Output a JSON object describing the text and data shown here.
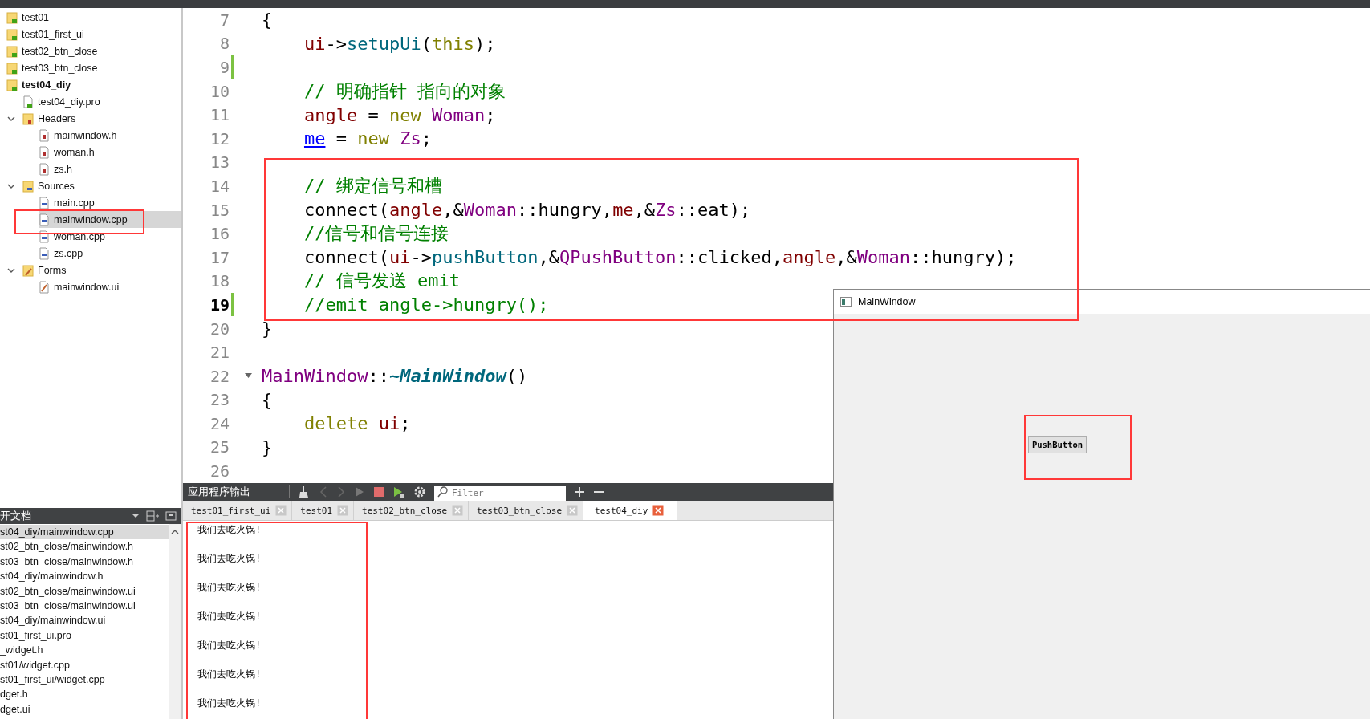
{
  "project_tree": [
    {
      "label": "test01",
      "kind": "project",
      "active": false,
      "selected": false
    },
    {
      "label": "test01_first_ui",
      "kind": "project",
      "active": false,
      "selected": false
    },
    {
      "label": "test02_btn_close",
      "kind": "project",
      "active": false,
      "selected": false
    },
    {
      "label": "test03_btn_close",
      "kind": "project",
      "active": false,
      "selected": false
    },
    {
      "label": "test04_diy",
      "kind": "project",
      "active": true,
      "selected": false,
      "children": [
        {
          "label": "test04_diy.pro",
          "kind": "pro",
          "selected": false
        },
        {
          "label": "Headers",
          "kind": "folder-headers",
          "expanded": true,
          "selected": false,
          "children": [
            {
              "label": "mainwindow.h",
              "kind": "header",
              "selected": false
            },
            {
              "label": "woman.h",
              "kind": "header",
              "selected": false
            },
            {
              "label": "zs.h",
              "kind": "header",
              "selected": false
            }
          ]
        },
        {
          "label": "Sources",
          "kind": "folder-sources",
          "expanded": true,
          "selected": false,
          "children": [
            {
              "label": "main.cpp",
              "kind": "source",
              "selected": false
            },
            {
              "label": "mainwindow.cpp",
              "kind": "source",
              "selected": true
            },
            {
              "label": "woman.cpp",
              "kind": "source",
              "selected": false
            },
            {
              "label": "zs.cpp",
              "kind": "source",
              "selected": false
            }
          ]
        },
        {
          "label": "Forms",
          "kind": "folder-forms",
          "expanded": true,
          "selected": false,
          "children": [
            {
              "label": "mainwindow.ui",
              "kind": "form",
              "selected": false
            }
          ]
        }
      ]
    }
  ],
  "open_documents": {
    "title": "开文档",
    "items": [
      {
        "label": "st04_diy/mainwindow.cpp",
        "selected": true
      },
      {
        "label": "st02_btn_close/mainwindow.h",
        "selected": false
      },
      {
        "label": "st03_btn_close/mainwindow.h",
        "selected": false
      },
      {
        "label": "st04_diy/mainwindow.h",
        "selected": false
      },
      {
        "label": "st02_btn_close/mainwindow.ui",
        "selected": false
      },
      {
        "label": "st03_btn_close/mainwindow.ui",
        "selected": false
      },
      {
        "label": "st04_diy/mainwindow.ui",
        "selected": false
      },
      {
        "label": "st01_first_ui.pro",
        "selected": false
      },
      {
        "label": "_widget.h",
        "selected": false
      },
      {
        "label": "st01/widget.cpp",
        "selected": false
      },
      {
        "label": "st01_first_ui/widget.cpp",
        "selected": false
      },
      {
        "label": "dget.h",
        "selected": false
      },
      {
        "label": "dget.ui",
        "selected": false
      }
    ]
  },
  "editor": {
    "lines": [
      {
        "number": "7",
        "current": false,
        "modified": false,
        "foldable": false,
        "tokens": [
          {
            "t": "{",
            "kind": "plain"
          }
        ]
      },
      {
        "number": "8",
        "current": false,
        "modified": false,
        "foldable": false,
        "indent": true,
        "tokens": [
          {
            "t": "ui",
            "kind": "member"
          },
          {
            "t": "->",
            "kind": "plain"
          },
          {
            "t": "setupUi",
            "kind": "func"
          },
          {
            "t": "(",
            "kind": "plain"
          },
          {
            "t": "this",
            "kind": "keyword"
          },
          {
            "t": ");",
            "kind": "plain"
          }
        ]
      },
      {
        "number": "9",
        "current": false,
        "modified": true,
        "foldable": false
      },
      {
        "number": "10",
        "current": false,
        "modified": false,
        "foldable": false,
        "indent": true,
        "tokens": [
          {
            "t": "// 明确指针 指向的对象",
            "kind": "comment"
          }
        ]
      },
      {
        "number": "11",
        "current": false,
        "modified": false,
        "foldable": false,
        "indent": true,
        "tokens": [
          {
            "t": "angle",
            "kind": "member"
          },
          {
            "t": " = ",
            "kind": "plain"
          },
          {
            "t": "new",
            "kind": "keyword"
          },
          {
            "t": " Woman",
            "kind": "type"
          },
          {
            "t": ";",
            "kind": "plain"
          }
        ]
      },
      {
        "number": "12",
        "current": false,
        "modified": false,
        "foldable": false,
        "indent": true,
        "tokens": [
          {
            "t": "me",
            "kind": "link"
          },
          {
            "t": " = ",
            "kind": "plain"
          },
          {
            "t": "new",
            "kind": "keyword"
          },
          {
            "t": " Zs",
            "kind": "type"
          },
          {
            "t": ";",
            "kind": "plain"
          }
        ]
      },
      {
        "number": "13",
        "current": false,
        "modified": false,
        "foldable": false
      },
      {
        "number": "14",
        "current": false,
        "modified": false,
        "foldable": false,
        "indent": true,
        "tokens": [
          {
            "t": "// 绑定信号和槽",
            "kind": "comment"
          }
        ]
      },
      {
        "number": "15",
        "current": false,
        "modified": false,
        "foldable": false,
        "indent": true,
        "tokens": [
          {
            "t": "connect(",
            "kind": "plain"
          },
          {
            "t": "angle",
            "kind": "member"
          },
          {
            "t": ",&",
            "kind": "plain"
          },
          {
            "t": "Woman",
            "kind": "type"
          },
          {
            "t": "::hungry,",
            "kind": "plain"
          },
          {
            "t": "me",
            "kind": "member"
          },
          {
            "t": ",&",
            "kind": "plain"
          },
          {
            "t": "Zs",
            "kind": "type"
          },
          {
            "t": "::eat);",
            "kind": "plain"
          }
        ]
      },
      {
        "number": "16",
        "current": false,
        "modified": false,
        "foldable": false,
        "indent": true,
        "tokens": [
          {
            "t": "//信号和信号连接",
            "kind": "comment"
          }
        ]
      },
      {
        "number": "17",
        "current": false,
        "modified": false,
        "foldable": false,
        "indent": true,
        "tokens": [
          {
            "t": "connect(",
            "kind": "plain"
          },
          {
            "t": "ui",
            "kind": "member"
          },
          {
            "t": "->",
            "kind": "plain"
          },
          {
            "t": "pushButton",
            "kind": "func"
          },
          {
            "t": ",&",
            "kind": "plain"
          },
          {
            "t": "QPushButton",
            "kind": "type"
          },
          {
            "t": "::clicked,",
            "kind": "plain"
          },
          {
            "t": "angle",
            "kind": "member"
          },
          {
            "t": ",&",
            "kind": "plain"
          },
          {
            "t": "Woman",
            "kind": "type"
          },
          {
            "t": "::hungry);",
            "kind": "plain"
          }
        ]
      },
      {
        "number": "18",
        "current": false,
        "modified": false,
        "foldable": false,
        "indent": true,
        "tokens": [
          {
            "t": "// 信号发送 emit",
            "kind": "comment"
          }
        ]
      },
      {
        "number": "19",
        "current": true,
        "modified": true,
        "foldable": false,
        "indent": true,
        "tokens": [
          {
            "t": "//emit angle->hungry();",
            "kind": "comment"
          }
        ]
      },
      {
        "number": "20",
        "current": false,
        "modified": false,
        "foldable": false,
        "tokens": [
          {
            "t": "}",
            "kind": "plain"
          }
        ]
      },
      {
        "number": "21",
        "current": false,
        "modified": false,
        "foldable": false
      },
      {
        "number": "22",
        "current": false,
        "modified": false,
        "foldable": true,
        "tokens": [
          {
            "t": "MainWindow",
            "kind": "type"
          },
          {
            "t": "::",
            "kind": "plain"
          },
          {
            "t": "~MainWindow",
            "kind": "funcdef"
          },
          {
            "t": "()",
            "kind": "plain"
          }
        ]
      },
      {
        "number": "23",
        "current": false,
        "modified": false,
        "foldable": false,
        "tokens": [
          {
            "t": "{",
            "kind": "plain"
          }
        ]
      },
      {
        "number": "24",
        "current": false,
        "modified": false,
        "foldable": false,
        "indent": true,
        "tokens": [
          {
            "t": "delete",
            "kind": "keyword"
          },
          {
            "t": " ui",
            "kind": "member"
          },
          {
            "t": ";",
            "kind": "plain"
          }
        ]
      },
      {
        "number": "25",
        "current": false,
        "modified": false,
        "foldable": false,
        "tokens": [
          {
            "t": "}",
            "kind": "plain"
          }
        ]
      },
      {
        "number": "26",
        "current": false,
        "modified": false,
        "foldable": false
      }
    ]
  },
  "output": {
    "title": "应用程序输出",
    "filter": {
      "placeholder": "Filter"
    },
    "tabs": [
      {
        "label": "test01_first_ui",
        "selected": false
      },
      {
        "label": "test01",
        "selected": false
      },
      {
        "label": "test02_btn_close",
        "selected": false
      },
      {
        "label": "test03_btn_close",
        "selected": false
      },
      {
        "label": "test04_diy",
        "selected": true
      }
    ],
    "lines": [
      "我们去吃火锅!",
      "我们去吃火锅!",
      "我们去吃火锅!",
      "我们去吃火锅!",
      "我们去吃火锅!",
      "我们去吃火锅!",
      "我们去吃火锅!"
    ]
  },
  "main_window": {
    "title": "MainWindow",
    "button": "PushButton"
  }
}
